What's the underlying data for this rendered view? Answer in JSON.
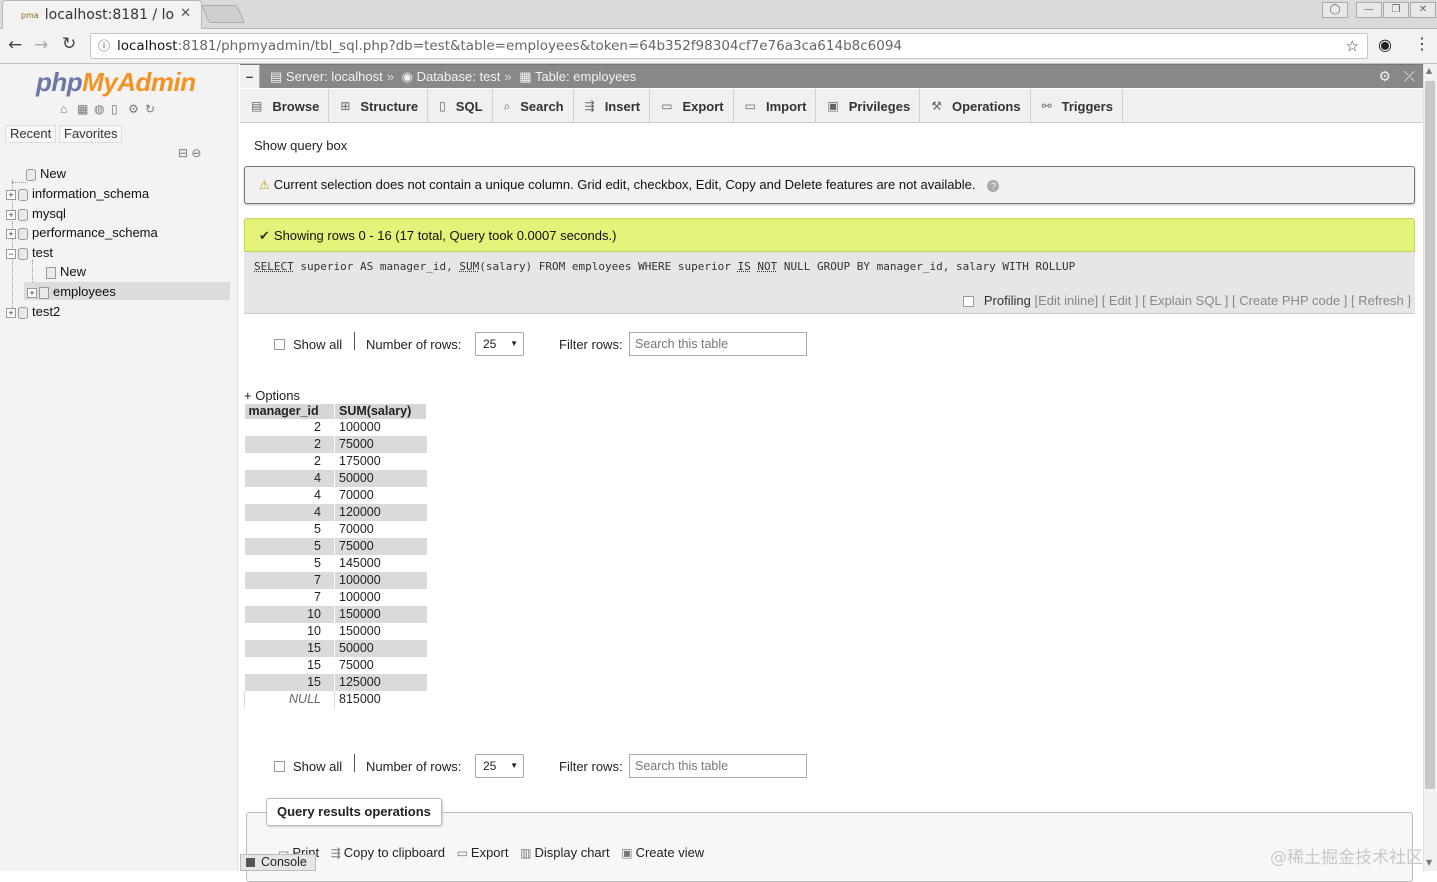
{
  "browser": {
    "tab_title": "localhost:8181 / lo",
    "url_host": "localhost",
    "url_rest": ":8181/phpmyadmin/tbl_sql.php?db=test&table=employees&token=64b352f98304cf7e76a3ca614b8c6094"
  },
  "sidebar": {
    "logo_part1": "php",
    "logo_part2": "MyAdmin",
    "tabs": [
      "Recent",
      "Favorites"
    ],
    "tree": {
      "new": "New",
      "dbs": [
        "information_schema",
        "mysql",
        "performance_schema",
        "test",
        "test2"
      ],
      "test_children": [
        "New",
        "employees"
      ]
    }
  },
  "breadcrumb": {
    "server": "Server: localhost",
    "database": "Database: test",
    "table": "Table: employees"
  },
  "tabs": [
    "Browse",
    "Structure",
    "SQL",
    "Search",
    "Insert",
    "Export",
    "Import",
    "Privileges",
    "Operations",
    "Triggers"
  ],
  "content": {
    "show_query_box": "Show query box",
    "notice": "Current selection does not contain a unique column. Grid edit, checkbox, Edit, Copy and Delete features are not available.",
    "success": "Showing rows 0 - 16 (17 total, Query took 0.0007 seconds.)",
    "sql": {
      "kw_select": "SELECT",
      "p1": " superior AS manager_id, ",
      "kw_sum": "SUM",
      "p2": "(salary) FROM employees WHERE superior ",
      "kw_is": "IS",
      "p3": " ",
      "kw_not": "NOT",
      "p4": " NULL GROUP BY manager_id, salary WITH ROLLUP"
    },
    "sql_links": {
      "profiling": "Profiling",
      "edit_inline": "[Edit inline]",
      "edit": "[ Edit ]",
      "explain": "[ Explain SQL ]",
      "create_php": "[ Create PHP code ]",
      "refresh": "[ Refresh ]"
    },
    "nav": {
      "show_all": "Show all",
      "number_of_rows": "Number of rows:",
      "rows_value": "25",
      "filter_rows": "Filter rows:",
      "search_placeholder": "Search this table"
    },
    "options": "+ Options",
    "columns": [
      "manager_id",
      "SUM(salary)"
    ],
    "rows": [
      [
        "2",
        "100000"
      ],
      [
        "2",
        "75000"
      ],
      [
        "2",
        "175000"
      ],
      [
        "4",
        "50000"
      ],
      [
        "4",
        "70000"
      ],
      [
        "4",
        "120000"
      ],
      [
        "5",
        "70000"
      ],
      [
        "5",
        "75000"
      ],
      [
        "5",
        "145000"
      ],
      [
        "7",
        "100000"
      ],
      [
        "7",
        "100000"
      ],
      [
        "10",
        "150000"
      ],
      [
        "10",
        "150000"
      ],
      [
        "15",
        "50000"
      ],
      [
        "15",
        "75000"
      ],
      [
        "15",
        "125000"
      ],
      [
        "NULL",
        "815000"
      ]
    ],
    "qro": {
      "legend": "Query results operations",
      "actions": [
        "Print",
        "Copy to clipboard",
        "Export",
        "Display chart",
        "Create view"
      ]
    }
  },
  "console": "Console",
  "watermark": "@稀土掘金技术社区"
}
